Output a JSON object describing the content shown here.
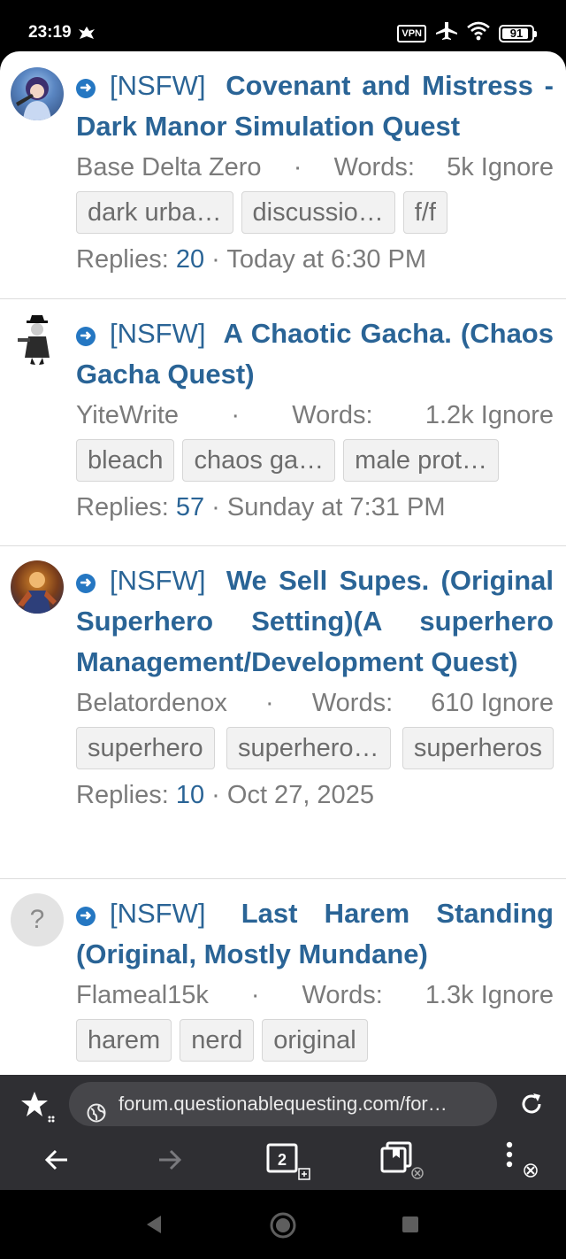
{
  "status": {
    "time": "23:19",
    "vpn": "VPN",
    "battery": "91",
    "battery_level": 0.91
  },
  "threads": [
    {
      "prefix": "[NSFW]",
      "title": "Covenant and Mistress - Dark Manor Simulation Quest",
      "author": "Base Delta Zero",
      "words_label": "Words:",
      "words": "5k",
      "ignore": "Ignore",
      "tags": [
        "dark urba…",
        "discussio…",
        "f/f"
      ],
      "replies_label": "Replies:",
      "replies": "20",
      "date": "Today at 6:30 PM"
    },
    {
      "prefix": "[NSFW]",
      "title": "A Chaotic Gacha. (Chaos Gacha Quest)",
      "author": "YiteWrite",
      "words_label": "Words:",
      "words": "1.2k",
      "ignore": "Ignore",
      "tags": [
        "bleach",
        "chaos ga…",
        "male prot…"
      ],
      "replies_label": "Replies:",
      "replies": "57",
      "date": "Sunday at 7:31 PM"
    },
    {
      "prefix": "[NSFW]",
      "title": "We Sell Supes. (Original Superhero Setting)(A superhero Management/Development Quest)",
      "author": "Belatordenox",
      "words_label": "Words:",
      "words": "610",
      "ignore": "Ignore",
      "tags": [
        "superhero",
        "superhero…",
        "superheros"
      ],
      "replies_label": "Replies:",
      "replies": "10",
      "date": "Oct 27, 2025"
    },
    {
      "prefix": "[NSFW]",
      "title": "Last Harem Standing (Original, Mostly Mundane)",
      "author": "Flameal15k",
      "words_label": "Words:",
      "words": "1.3k",
      "ignore": "Ignore",
      "tags": [
        "harem",
        "nerd",
        "original"
      ],
      "avatar_letter": "?"
    }
  ],
  "browser": {
    "url": "forum.questionablequesting.com/for…",
    "tab_count": "2"
  },
  "colors": {
    "link": "#2a6496",
    "meta": "#7b7b7b",
    "browser_bg": "#2f2f33"
  }
}
